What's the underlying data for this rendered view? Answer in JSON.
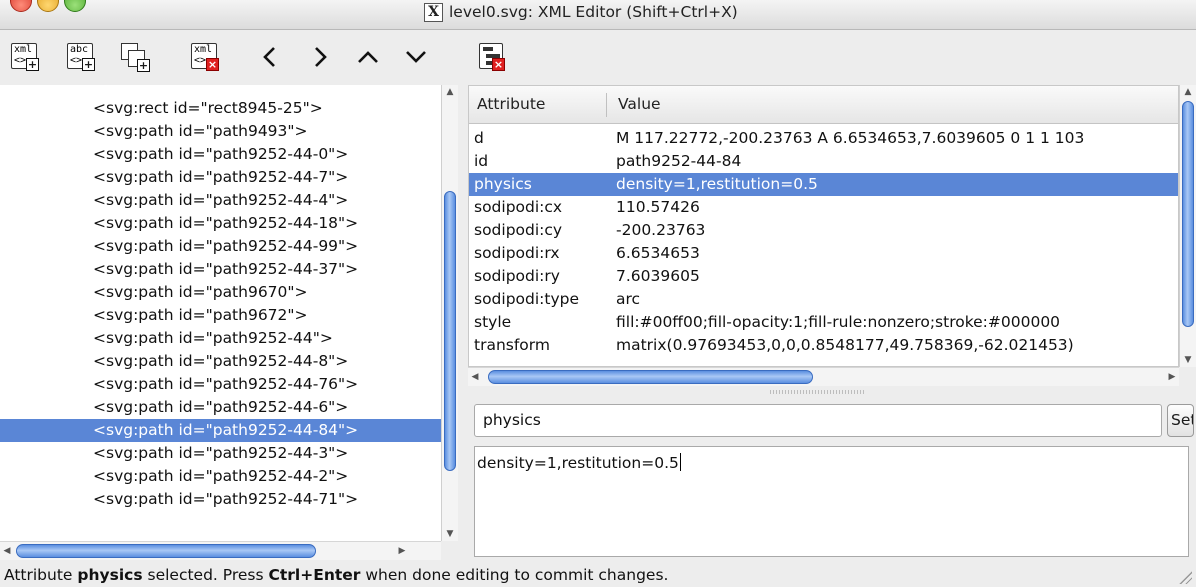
{
  "window": {
    "title": "level0.svg: XML Editor (Shift+Ctrl+X)",
    "x_logo": "X"
  },
  "toolbar": {
    "new_element_node": {
      "top": "xml",
      "bottom": "<>",
      "badge": "+"
    },
    "new_text_node": {
      "top": "abc",
      "bottom": "<>",
      "badge": "+"
    },
    "duplicate_node": {
      "badge": "+"
    },
    "delete_node": {
      "top": "xml",
      "bottom": "<>",
      "badge": "×"
    },
    "delete_attribute": {
      "badge": "×"
    }
  },
  "tree": {
    "clipped_top": "⌐",
    "rows": [
      "<svg:rect id=\"rect8945-25\">",
      "<svg:path id=\"path9493\">",
      "<svg:path id=\"path9252-44-0\">",
      "<svg:path id=\"path9252-44-7\">",
      "<svg:path id=\"path9252-44-4\">",
      "<svg:path id=\"path9252-44-18\">",
      "<svg:path id=\"path9252-44-99\">",
      "<svg:path id=\"path9252-44-37\">",
      "<svg:path id=\"path9670\">",
      "<svg:path id=\"path9672\">",
      "<svg:path id=\"path9252-44\">",
      "<svg:path id=\"path9252-44-8\">",
      "<svg:path id=\"path9252-44-76\">",
      "<svg:path id=\"path9252-44-6\">",
      "<svg:path id=\"path9252-44-84\">",
      "<svg:path id=\"path9252-44-3\">",
      "<svg:path id=\"path9252-44-2\">",
      "<svg:path id=\"path9252-44-71\">"
    ],
    "selected_index": 14,
    "vscroll_fraction": 0.62
  },
  "attributes": {
    "header": {
      "attribute": "Attribute",
      "value": "Value"
    },
    "rows": [
      {
        "name": "d",
        "value": "M 117.22772,-200.23763 A 6.6534653,7.6039605 0 1 1 103"
      },
      {
        "name": "id",
        "value": "path9252-44-84"
      },
      {
        "name": "physics",
        "value": "density=1,restitution=0.5"
      },
      {
        "name": "sodipodi:cx",
        "value": "110.57426"
      },
      {
        "name": "sodipodi:cy",
        "value": "-200.23763"
      },
      {
        "name": "sodipodi:rx",
        "value": "6.6534653"
      },
      {
        "name": "sodipodi:ry",
        "value": "7.6039605"
      },
      {
        "name": "sodipodi:type",
        "value": "arc"
      },
      {
        "name": "style",
        "value": "fill:#00ff00;fill-opacity:1;fill-rule:nonzero;stroke:#000000"
      },
      {
        "name": "transform",
        "value": "matrix(0.97693453,0,0,0.8548177,49.758369,-62.021453)"
      }
    ],
    "selected_index": 2
  },
  "editor": {
    "name_value": "physics",
    "set_label": "Set",
    "value_text": "density=1,restitution=0.5"
  },
  "status": {
    "part1": "Attribute ",
    "attr_name": "physics",
    "part2": " selected. Press ",
    "shortcut": "Ctrl+Enter",
    "part3": " when done editing to commit changes."
  },
  "colors": {
    "selection": "#5a86d6",
    "scroll_thumb": "#5b8fe0",
    "background": "#ededed"
  }
}
